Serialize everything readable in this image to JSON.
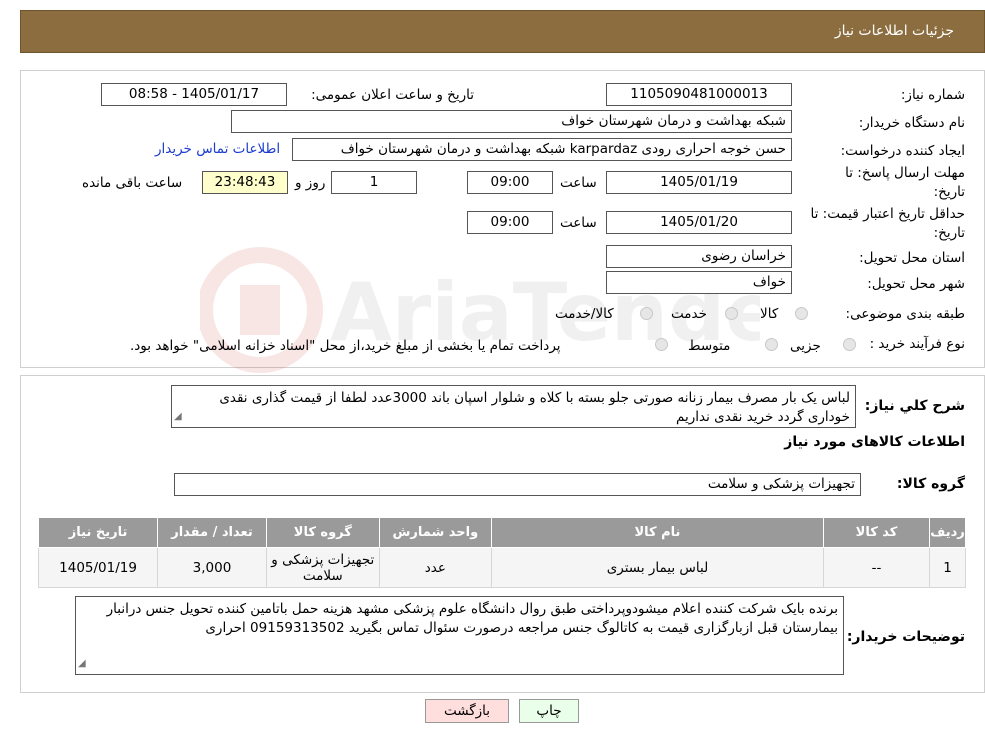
{
  "header": {
    "title": "جزئیات اطلاعات نیاز"
  },
  "form": {
    "need_number_label": "شماره نیاز:",
    "need_number": "1105090481000013",
    "announce_label": "تاریخ و ساعت اعلان عمومی:",
    "announce_value": "1405/01/17 - 08:58",
    "buyer_org_label": "نام دستگاه خریدار:",
    "buyer_org": "شبکه بهداشت و درمان شهرستان خواف",
    "requester_label": "ایجاد کننده درخواست:",
    "requester": "حسن خوجه احراری رودی karpardaz شبکه بهداشت و درمان شهرستان خواف",
    "contact_link": "اطلاعات تماس خریدار",
    "deadline_label_1": "مهلت ارسال پاسخ: تا",
    "deadline_label_2": "تاریخ:",
    "deadline_date": "1405/01/19",
    "time_label": "ساعت",
    "deadline_time": "09:00",
    "days_value": "1",
    "days_label": "روز و",
    "remaining_time": "23:48:43",
    "remaining_label": "ساعت باقی مانده",
    "validity_label_1": "حداقل تاریخ اعتبار قیمت: تا",
    "validity_label_2": "تاریخ:",
    "validity_date": "1405/01/20",
    "validity_time": "09:00",
    "province_label": "استان محل تحویل:",
    "province": "خراسان رضوی",
    "city_label": "شهر محل تحویل:",
    "city": "خواف",
    "category_label": "طبقه بندی موضوعی:",
    "category_options": [
      "کالا",
      "خدمت",
      "کالا/خدمت"
    ],
    "process_label": "نوع فرآیند خرید :",
    "process_options": [
      "جزیی",
      "متوسط"
    ],
    "process_note": "پرداخت تمام یا بخشی از مبلغ خرید،از محل \"اسناد خزانه اسلامی\" خواهد بود."
  },
  "details": {
    "summary_label": "شرح کلي نياز:",
    "summary": "لباس یک بار مصرف بیمار زنانه صورتی جلو بسته با کلاه و شلوار اسپان باند 3000عدد لطفا از قیمت گذاری نقدی خوداری گردد خرید نقدی نداریم",
    "goods_info_title": "اطلاعات کالاهای مورد نیاز",
    "goods_group_label": "گروه کالا:",
    "goods_group": "تجهیزات پزشکی و سلامت"
  },
  "table": {
    "headers": [
      "ردیف",
      "کد کالا",
      "نام کالا",
      "واحد شمارش",
      "گروه کالا",
      "تعداد / مقدار",
      "تاریخ نیاز"
    ],
    "rows": [
      [
        "1",
        "--",
        "لباس بیمار بستری",
        "عدد",
        "تجهیزات پزشکی و سلامت",
        "3,000",
        "1405/01/19"
      ]
    ]
  },
  "notes": {
    "label": "توضیحات خریدار:",
    "text": "برنده بایک شرکت کننده اعلام میشودوپرداختی طبق روال دانشگاه علوم پزشکی مشهد هزینه حمل باتامین کننده تحویل جنس درانبار بیمارستان قبل ازبارگزاری قیمت به کاتالوگ جنس مراجعه درصورت سئوال تماس بگیرید 09159313502 احراری"
  },
  "buttons": {
    "print": "چاپ",
    "back": "بازگشت"
  },
  "colors": {
    "header_bg": "#8b6d3f",
    "table_header_bg": "#9a9a9a",
    "timer_bg": "#ffffcc",
    "back_button_bg": "#ffdede",
    "print_button_bg": "#eaffea",
    "link": "#1a3ccf"
  }
}
